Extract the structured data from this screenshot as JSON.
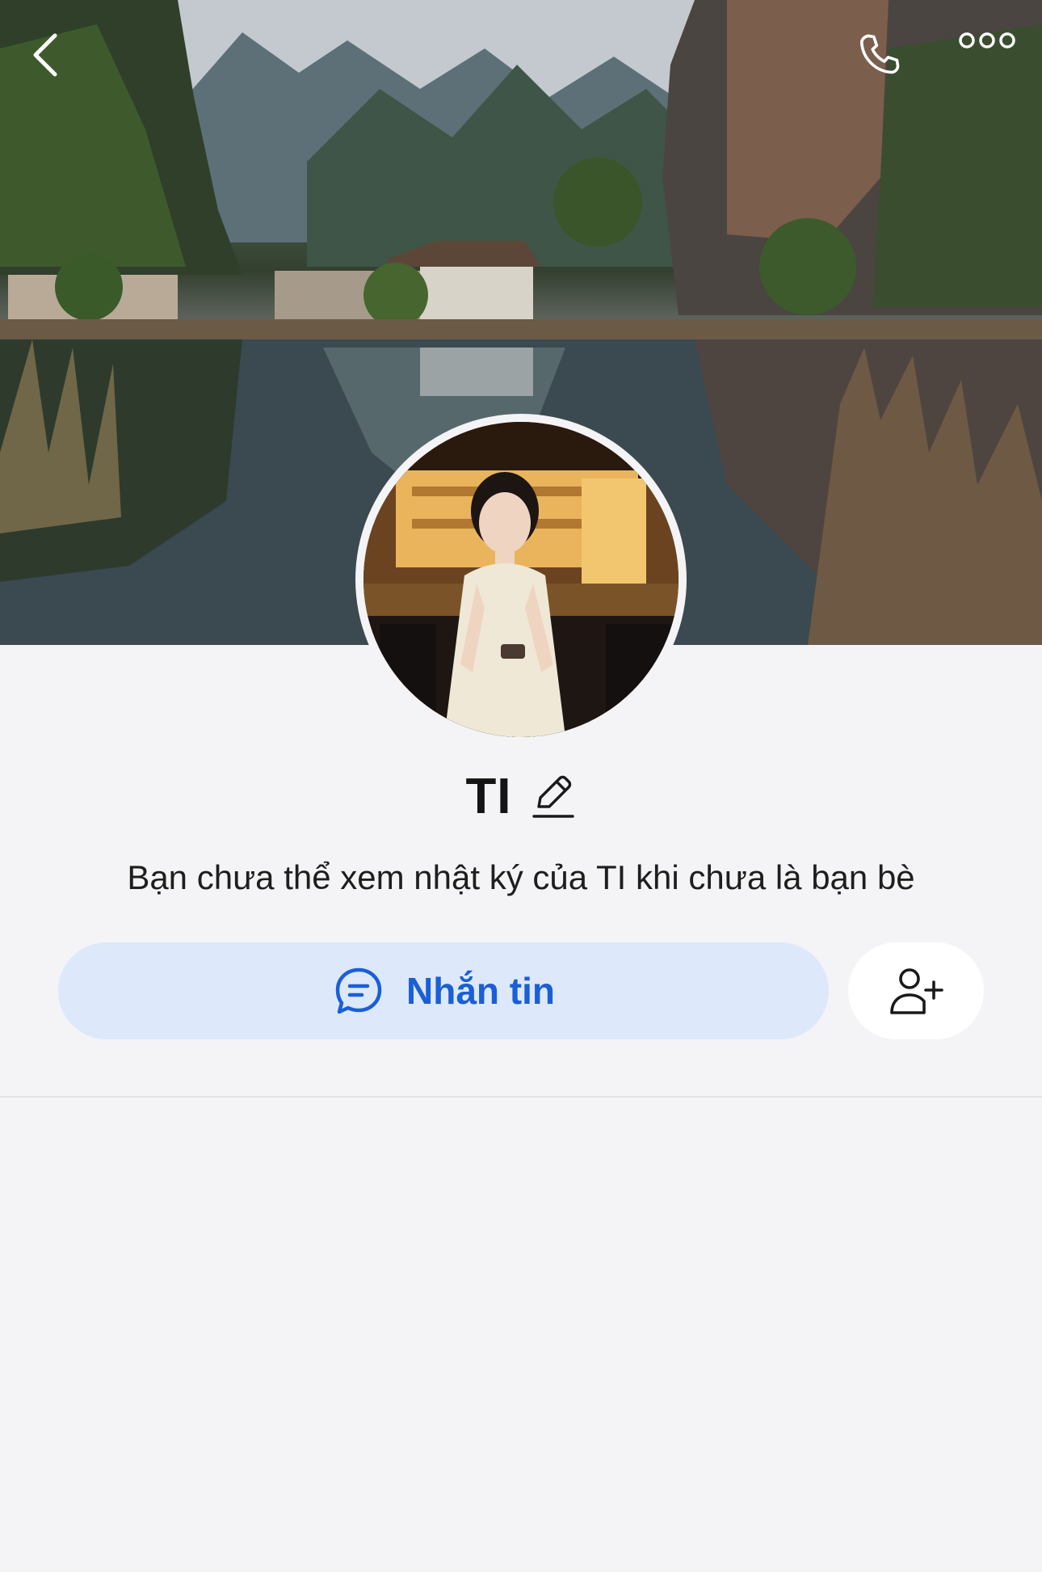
{
  "header": {
    "back_icon": "chevron-left-icon",
    "call_icon": "phone-icon",
    "more_icon": "more-options-icon"
  },
  "profile": {
    "name": "TI",
    "edit_icon": "pencil-icon",
    "notice": "Bạn chưa thể xem nhật ký của TI khi chưa là bạn bè"
  },
  "actions": {
    "message_label": "Nhắn tin",
    "message_icon": "chat-bubble-icon",
    "add_friend_icon": "add-user-icon"
  },
  "colors": {
    "accent": "#1a5fd6",
    "message_button_bg": "#dde8fb",
    "background": "#f4f4f6"
  }
}
